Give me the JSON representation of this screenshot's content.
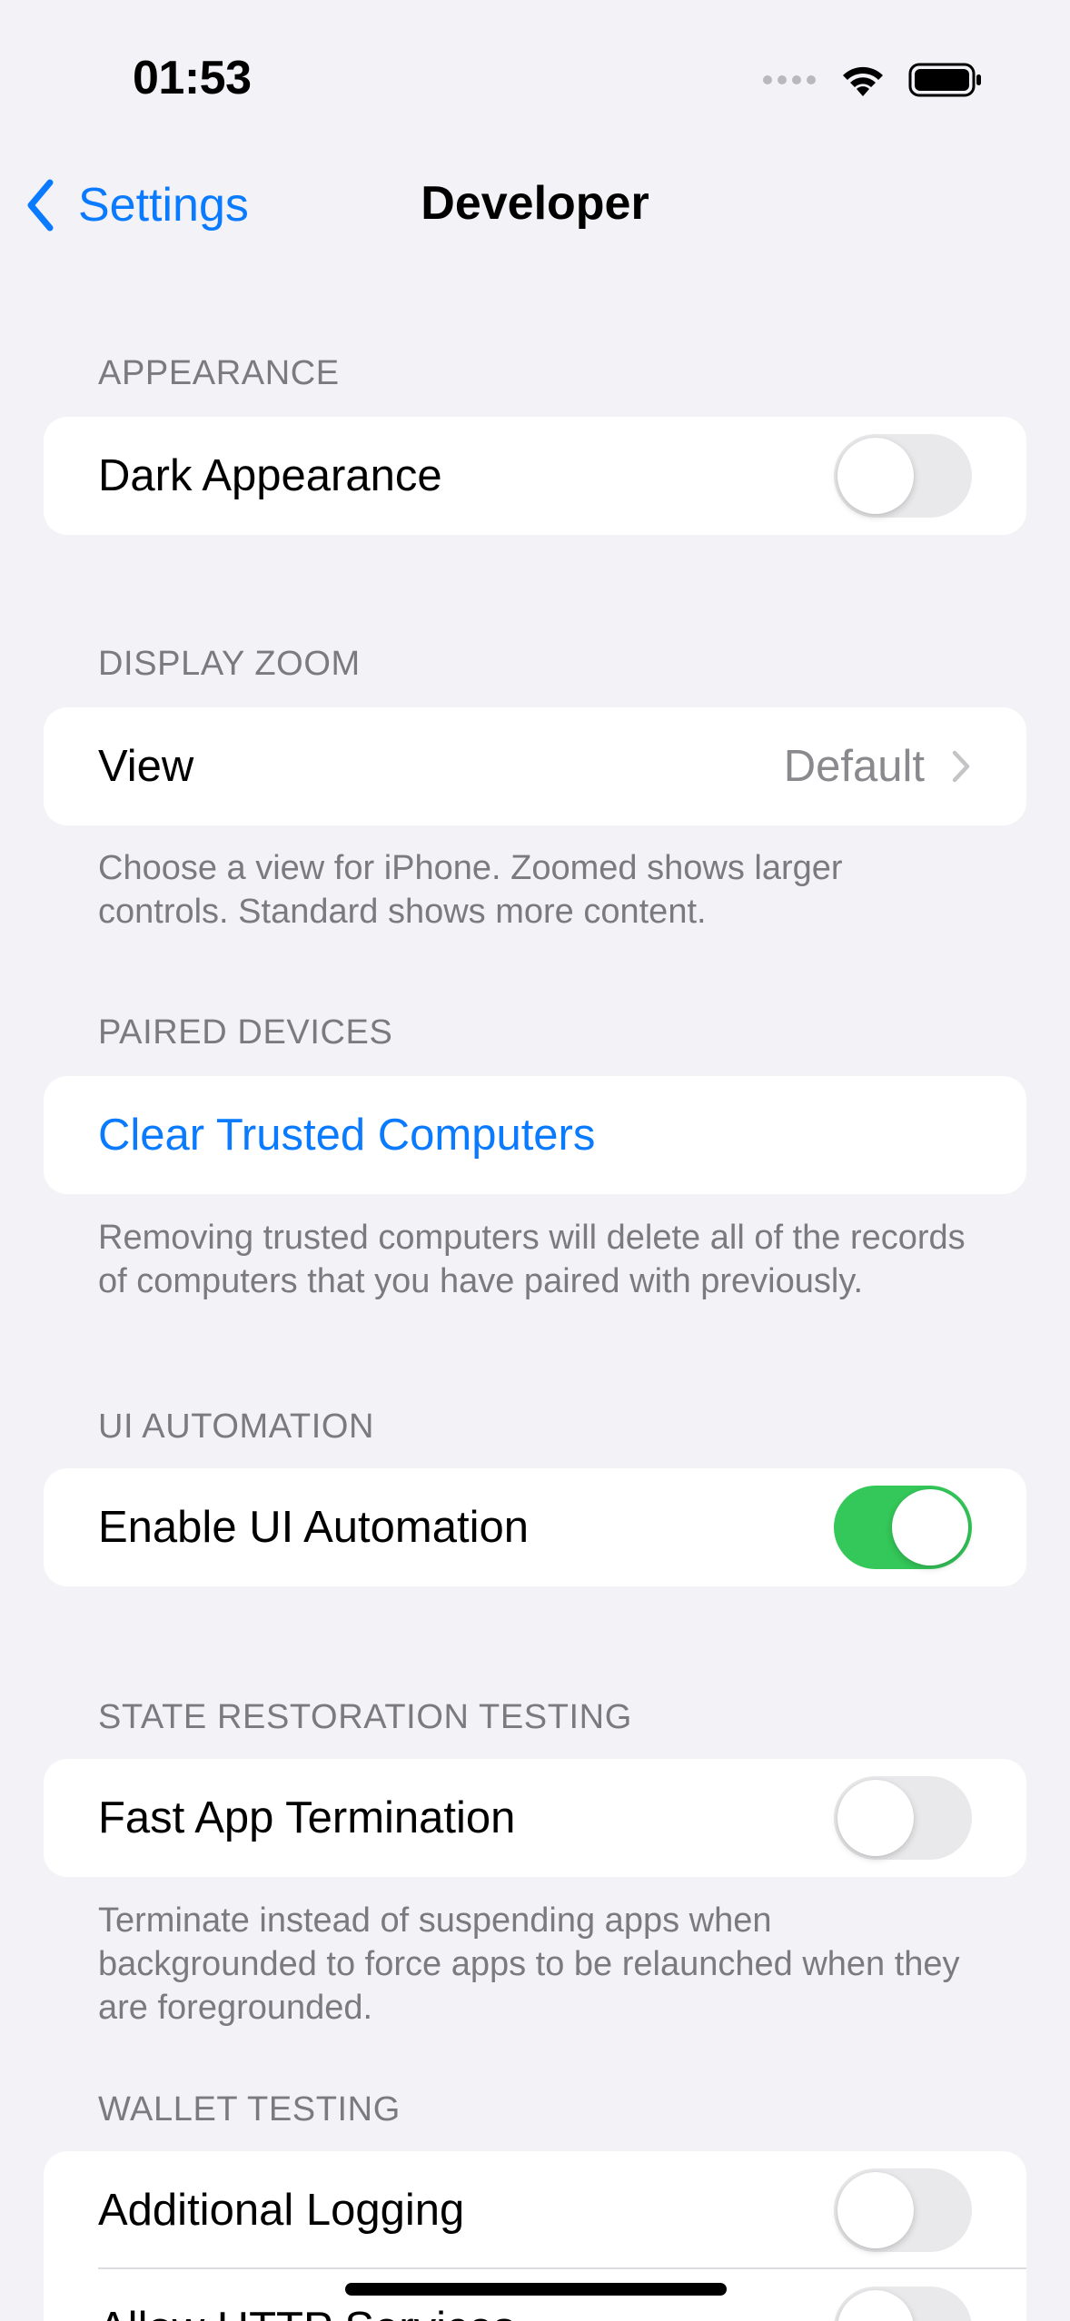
{
  "status_bar": {
    "time": "01:53"
  },
  "nav": {
    "back_label": "Settings",
    "title": "Developer"
  },
  "sections": {
    "appearance": {
      "header": "APPEARANCE",
      "dark_appearance": {
        "label": "Dark Appearance",
        "on": false
      }
    },
    "display_zoom": {
      "header": "DISPLAY ZOOM",
      "view": {
        "label": "View",
        "value": "Default"
      },
      "footer": "Choose a view for iPhone. Zoomed shows larger controls. Standard shows more content."
    },
    "paired_devices": {
      "header": "PAIRED DEVICES",
      "clear_label": "Clear Trusted Computers",
      "footer": "Removing trusted computers will delete all of the records of computers that you have paired with previously."
    },
    "ui_automation": {
      "header": "UI AUTOMATION",
      "enable": {
        "label": "Enable UI Automation",
        "on": true
      }
    },
    "state_restoration": {
      "header": "STATE RESTORATION TESTING",
      "fast_termination": {
        "label": "Fast App Termination",
        "on": false
      },
      "footer": "Terminate instead of suspending apps when backgrounded to force apps to be relaunched when they are foregrounded."
    },
    "wallet_testing": {
      "header": "WALLET TESTING",
      "additional_logging": {
        "label": "Additional Logging",
        "on": false
      },
      "http_services": {
        "label": "Allow HTTP Services",
        "on": false
      }
    }
  },
  "colors": {
    "accent": "#0A7AFF",
    "toggle_on": "#34C759",
    "toggle_off": "#E9E9EB",
    "background": "#F2F2F7"
  }
}
